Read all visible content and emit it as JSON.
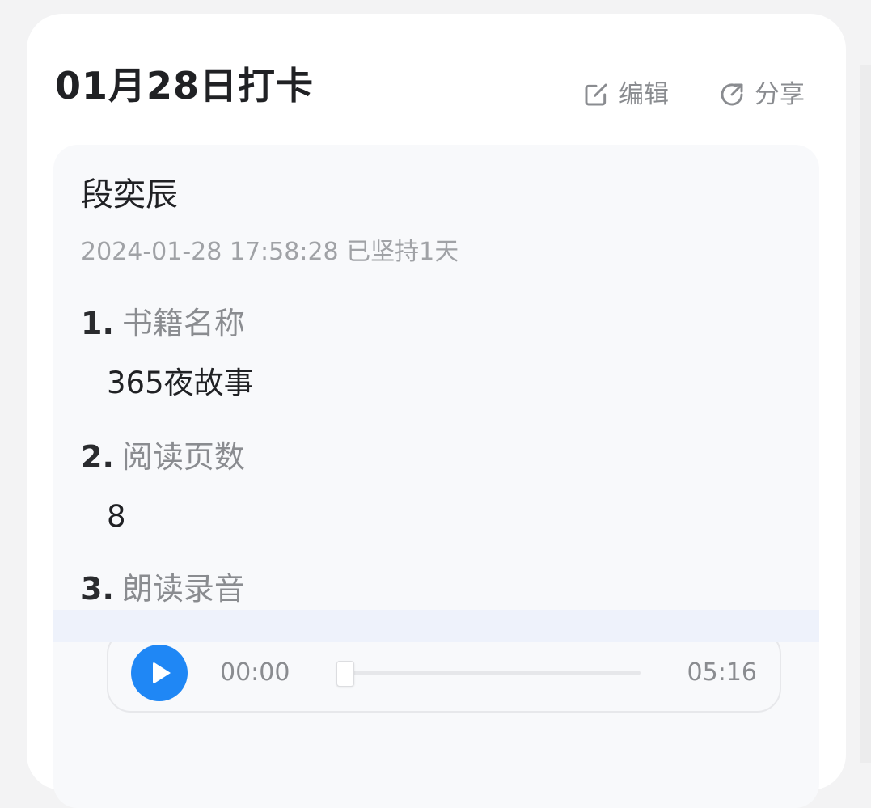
{
  "header": {
    "title": "01月28日打卡",
    "edit_label": "编辑",
    "share_label": "分享"
  },
  "entry": {
    "name": "段奕辰",
    "meta": "2024-01-28 17:58:28 已坚持1天",
    "questions": [
      {
        "num": "1.",
        "label": "书籍名称",
        "answer": "365夜故事"
      },
      {
        "num": "2.",
        "label": "阅读页数",
        "answer": "8"
      },
      {
        "num": "3.",
        "label": "朗读录音"
      }
    ]
  },
  "audio": {
    "current_time": "00:00",
    "total_time": "05:16",
    "progress": 0
  },
  "colors": {
    "accent": "#1f87f5",
    "background": "#f3f3f4",
    "card": "#ffffff",
    "inner": "#f8f9fb"
  },
  "icons": [
    "edit-icon",
    "share-icon",
    "play-icon"
  ]
}
